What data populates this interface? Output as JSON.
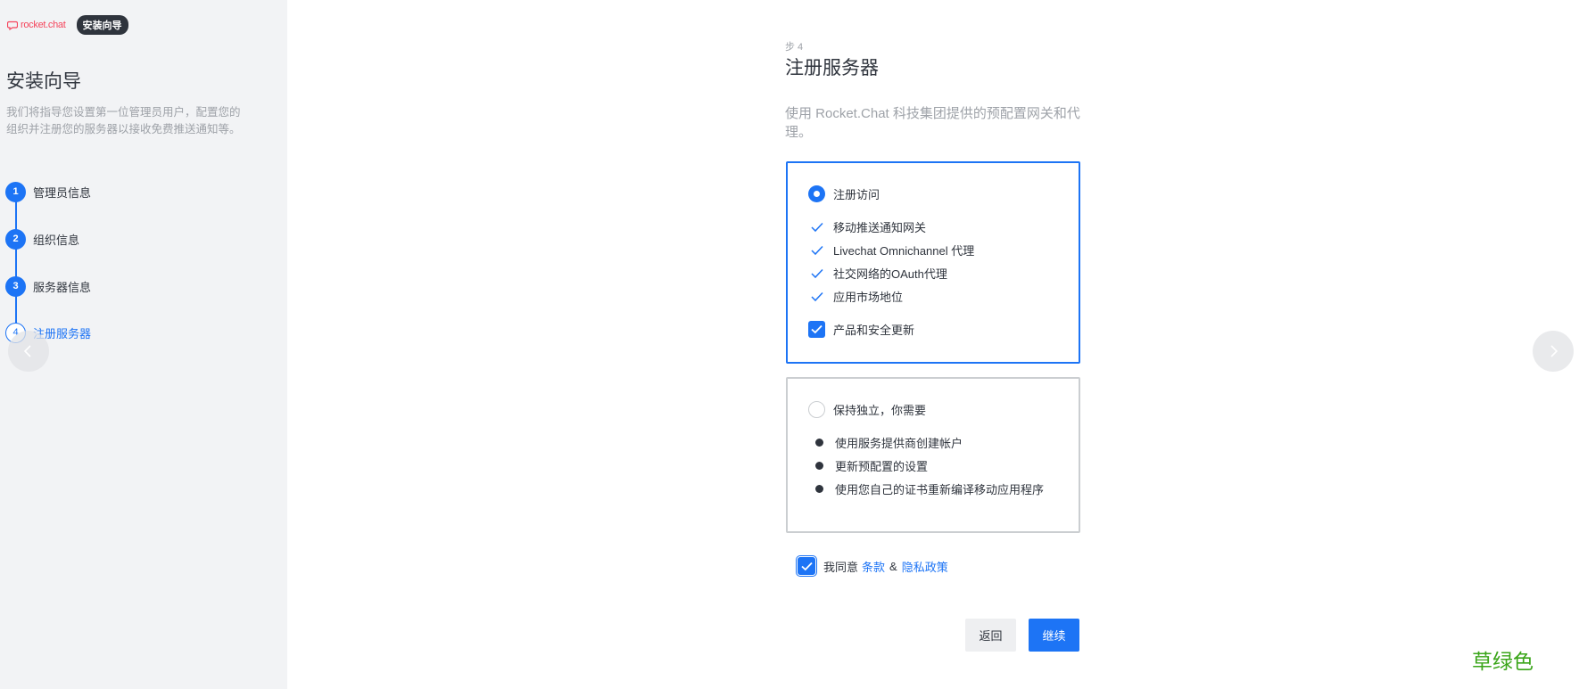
{
  "sidebar": {
    "logo_text": "rocket.chat",
    "badge": "安装向导",
    "title": "安装向导",
    "description": "我们将指导您设置第一位管理员用户，配置您的组织并注册您的服务器以接收免费推送通知等。",
    "steps": [
      {
        "number": "1",
        "label": "管理员信息"
      },
      {
        "number": "2",
        "label": "组织信息"
      },
      {
        "number": "3",
        "label": "服务器信息"
      },
      {
        "number": "4",
        "label": "注册服务器"
      }
    ],
    "current_step": 4
  },
  "main": {
    "step_caption": "步 4",
    "title": "注册服务器",
    "description": "使用 Rocket.Chat 科技集团提供的预配置网关和代理。",
    "option_register": {
      "label": "注册访问",
      "selected": true,
      "features": [
        "移动推送通知网关",
        "Livechat Omnichannel 代理",
        "社交网络的OAuth代理",
        "应用市场地位"
      ],
      "updates_checkbox": {
        "label": "产品和安全更新",
        "checked": true
      }
    },
    "option_standalone": {
      "label": "保持独立，你需要",
      "selected": false,
      "items": [
        "使用服务提供商创建帐户",
        "更新预配置的设置",
        "使用您自己的证书重新编译移动应用程序"
      ]
    },
    "agree": {
      "prefix": "我同意",
      "terms_link": "条款",
      "separator": "&",
      "privacy_link": "隐私政策",
      "checked": true
    },
    "buttons": {
      "back": "返回",
      "continue": "继续"
    }
  },
  "watermark": "草绿色",
  "colors": {
    "accent": "#1d74f5",
    "sidebar_bg": "#f2f3f5",
    "brand_red": "#f5455c",
    "watermark_green": "#3aa519"
  },
  "icons": {
    "prev": "chevron-left-icon",
    "next": "chevron-right-icon",
    "feature": "checkmark-icon"
  }
}
